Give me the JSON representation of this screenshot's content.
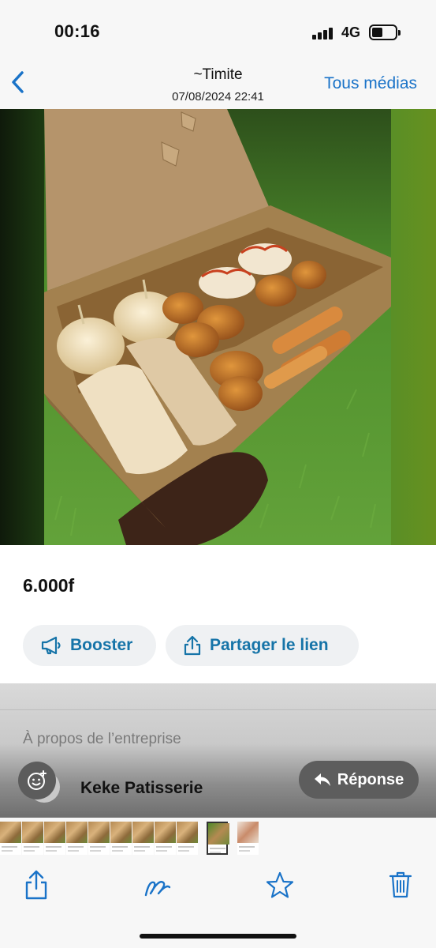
{
  "status_bar": {
    "time": "00:16",
    "network": "4G"
  },
  "nav": {
    "back_icon": "chevron-left-icon",
    "title": "~Timite",
    "subtitle": "07/08/2024 22:41",
    "all_media": "Tous médias"
  },
  "product": {
    "price": "6.000f",
    "booster_label": "Booster",
    "booster_icon": "megaphone-icon",
    "share_label": "Partager le lien",
    "share_icon": "share-icon"
  },
  "business": {
    "about_label": "À propos de l’entreprise",
    "name": "Keke Patisserie"
  },
  "overlay": {
    "reply_label": "Réponse",
    "reply_icon": "reply-arrow-icon",
    "emoji_icon": "add-reaction-icon"
  },
  "toolbar": {
    "icons": [
      "share-icon",
      "markup-icon",
      "star-icon",
      "trash-icon"
    ]
  },
  "colors": {
    "accent": "#1a73c8",
    "pill_text": "#1674a8",
    "pill_bg": "#eff1f3"
  }
}
